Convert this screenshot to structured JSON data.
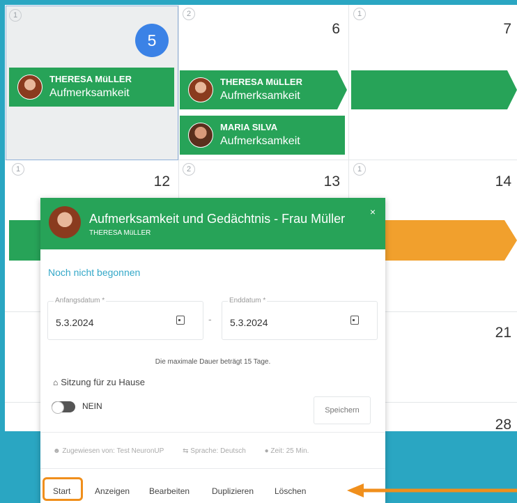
{
  "calendar": {
    "row1": [
      {
        "count": "1",
        "day": "5"
      },
      {
        "count": "2",
        "day": "6"
      },
      {
        "count": "1",
        "day": "7"
      }
    ],
    "row2": [
      {
        "count": "1",
        "day": "12"
      },
      {
        "count": "2",
        "day": "13"
      },
      {
        "count": "1",
        "day": "14"
      }
    ],
    "row3_day": "21",
    "row4_day": "28",
    "events": [
      {
        "name": "THERESA MüLLER",
        "type": "Aufmerksamkeit"
      },
      {
        "name": "THERESA MüLLER",
        "type": "Aufmerksamkeit"
      },
      {
        "name": "MARIA SILVA",
        "type": "Aufmerksamkeit"
      }
    ]
  },
  "popup": {
    "title": "Aufmerksamkeit und Gedächtnis - Frau Müller",
    "subtitle": "THERESA MüLLER",
    "close": "×",
    "status": "Noch nicht begonnen",
    "start_label": "Anfangsdatum *",
    "start_value": "5.3.2024",
    "dash": "-",
    "end_label": "Enddatum *",
    "end_value": "5.3.2024",
    "max_note": "Die maximale Dauer beträgt 15 Tage.",
    "home_label": "Sitzung für zu Hause",
    "toggle_label": "NEIN",
    "save": "Speichern",
    "assigned": "Zugewiesen von: Test NeuronUP",
    "language": "Sprache: Deutsch",
    "time": "Zeit: 25 Min.",
    "actions": {
      "start": "Start",
      "view": "Anzeigen",
      "edit": "Bearbeiten",
      "duplicate": "Duplizieren",
      "delete": "Löschen"
    }
  },
  "colors": {
    "background": "#2aa6c2",
    "event_green": "#27a358",
    "today_blue": "#3b82e6",
    "orange": "#f1a02d",
    "highlight": "#f08f1c"
  }
}
